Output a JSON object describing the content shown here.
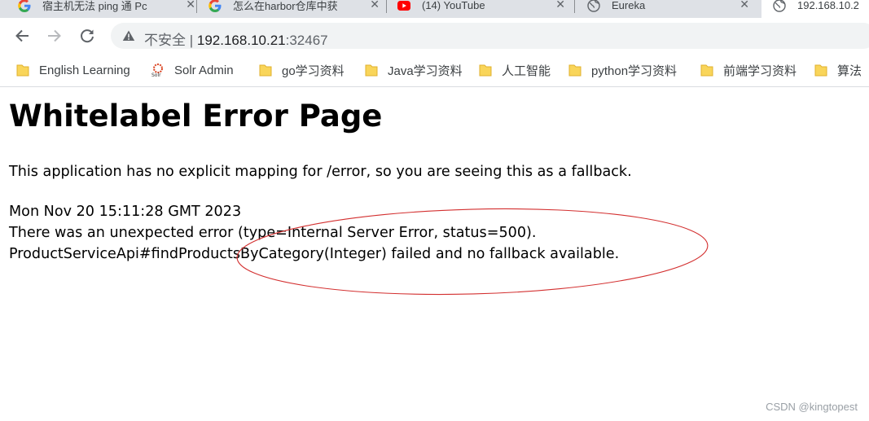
{
  "tabs": [
    {
      "title": "宿主机无法 ping 通 Pc",
      "icon": "google-g-icon"
    },
    {
      "title": "怎么在harbor仓库中获",
      "icon": "google-g-icon"
    },
    {
      "title": "(14) YouTube",
      "icon": "youtube-icon"
    },
    {
      "title": "Eureka",
      "icon": "globe-icon"
    },
    {
      "title": "192.168.10.2",
      "icon": "globe-icon",
      "active": true
    }
  ],
  "tab_close_glyph": "✕",
  "omnibox": {
    "security_label": "不安全",
    "separator": "|",
    "host": "192.168.10.21",
    "port": ":32467"
  },
  "bookmarks": [
    {
      "label": "English Learning",
      "icon": "folder-icon"
    },
    {
      "label": "Solr Admin",
      "icon": "solr-icon"
    },
    {
      "label": "go学习资料",
      "icon": "folder-icon"
    },
    {
      "label": "Java学习资料",
      "icon": "folder-icon"
    },
    {
      "label": "人工智能",
      "icon": "folder-icon"
    },
    {
      "label": "python学习资料",
      "icon": "folder-icon"
    },
    {
      "label": "前端学习资料",
      "icon": "folder-icon"
    },
    {
      "label": "算法",
      "icon": "folder-icon"
    }
  ],
  "page": {
    "heading": "Whitelabel Error Page",
    "intro": "This application has no explicit mapping for /error, so you are seeing this as a fallback.",
    "timestamp": "Mon Nov 20 15:11:28 GMT 2023",
    "error_line": "There was an unexpected error (type=Internal Server Error, status=500).",
    "detail_line": "ProductServiceApi#findProductsByCategory(Integer) failed and no fallback available."
  },
  "annotation_color": "#d32f2f",
  "watermark": "CSDN @kingtopest"
}
